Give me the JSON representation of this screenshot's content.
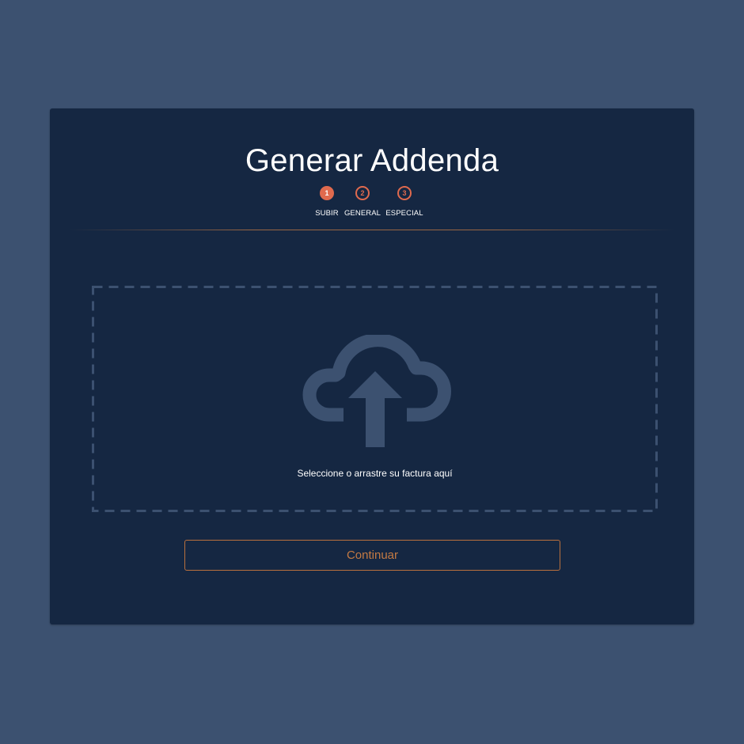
{
  "header": {
    "title": "Generar Addenda"
  },
  "steps": [
    {
      "number": "1",
      "label": "SUBIR",
      "active": true
    },
    {
      "number": "2",
      "label": "GENERAL",
      "active": false
    },
    {
      "number": "3",
      "label": "ESPECIAL",
      "active": false
    }
  ],
  "dropzone": {
    "text": "Seleccione o arrastre su factura aquí",
    "icon": "cloud-upload-icon"
  },
  "actions": {
    "continue_label": "Continuar"
  },
  "colors": {
    "background": "#3c5170",
    "card": "#152742",
    "accent": "#e06a4e",
    "button_border": "#b9703e",
    "icon": "#3c5170"
  }
}
